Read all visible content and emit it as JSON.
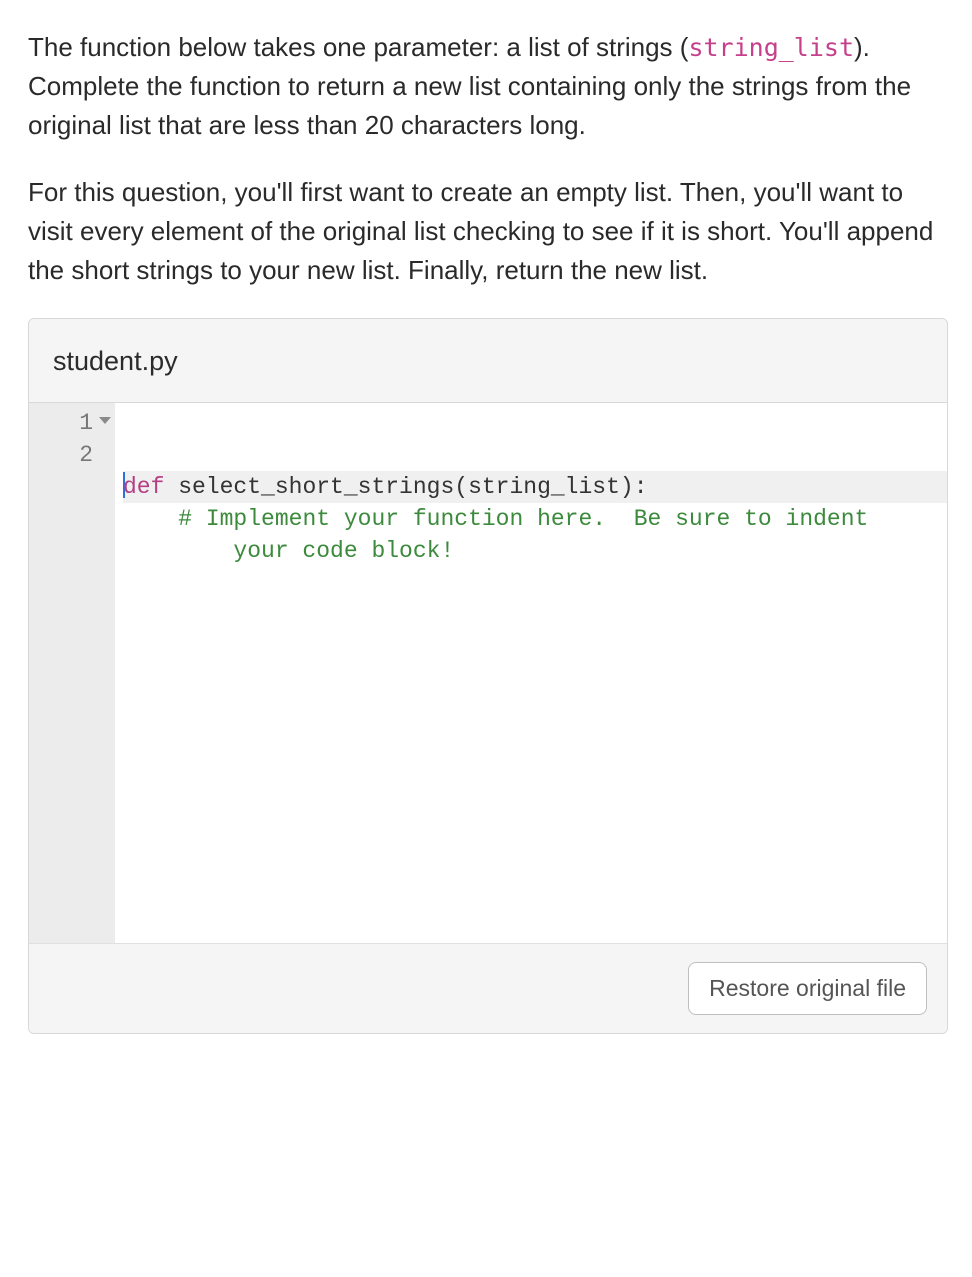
{
  "prompt": {
    "p1a": "The function below takes one parameter: a list of strings (",
    "p1_code": "string_list",
    "p1b": "). Complete the function to return a new list containing only the strings from the original list that are less than 20 characters long.",
    "p2": "For this question, you'll first want to create an empty list. Then, you'll want to visit every element of the original list checking to see if it is short. You'll append the short strings to your new list. Finally, return the new list."
  },
  "editor": {
    "filename": "student.py",
    "gutter": [
      "1",
      "2"
    ],
    "line1": {
      "kw": "def",
      "rest": " select_short_strings(string_list):"
    },
    "line2": {
      "indent": "    ",
      "comment_a": "# Implement your function here.  Be sure to indent",
      "wrap_indent": "        ",
      "comment_b": "your code block!"
    },
    "restore_label": "Restore original file"
  }
}
